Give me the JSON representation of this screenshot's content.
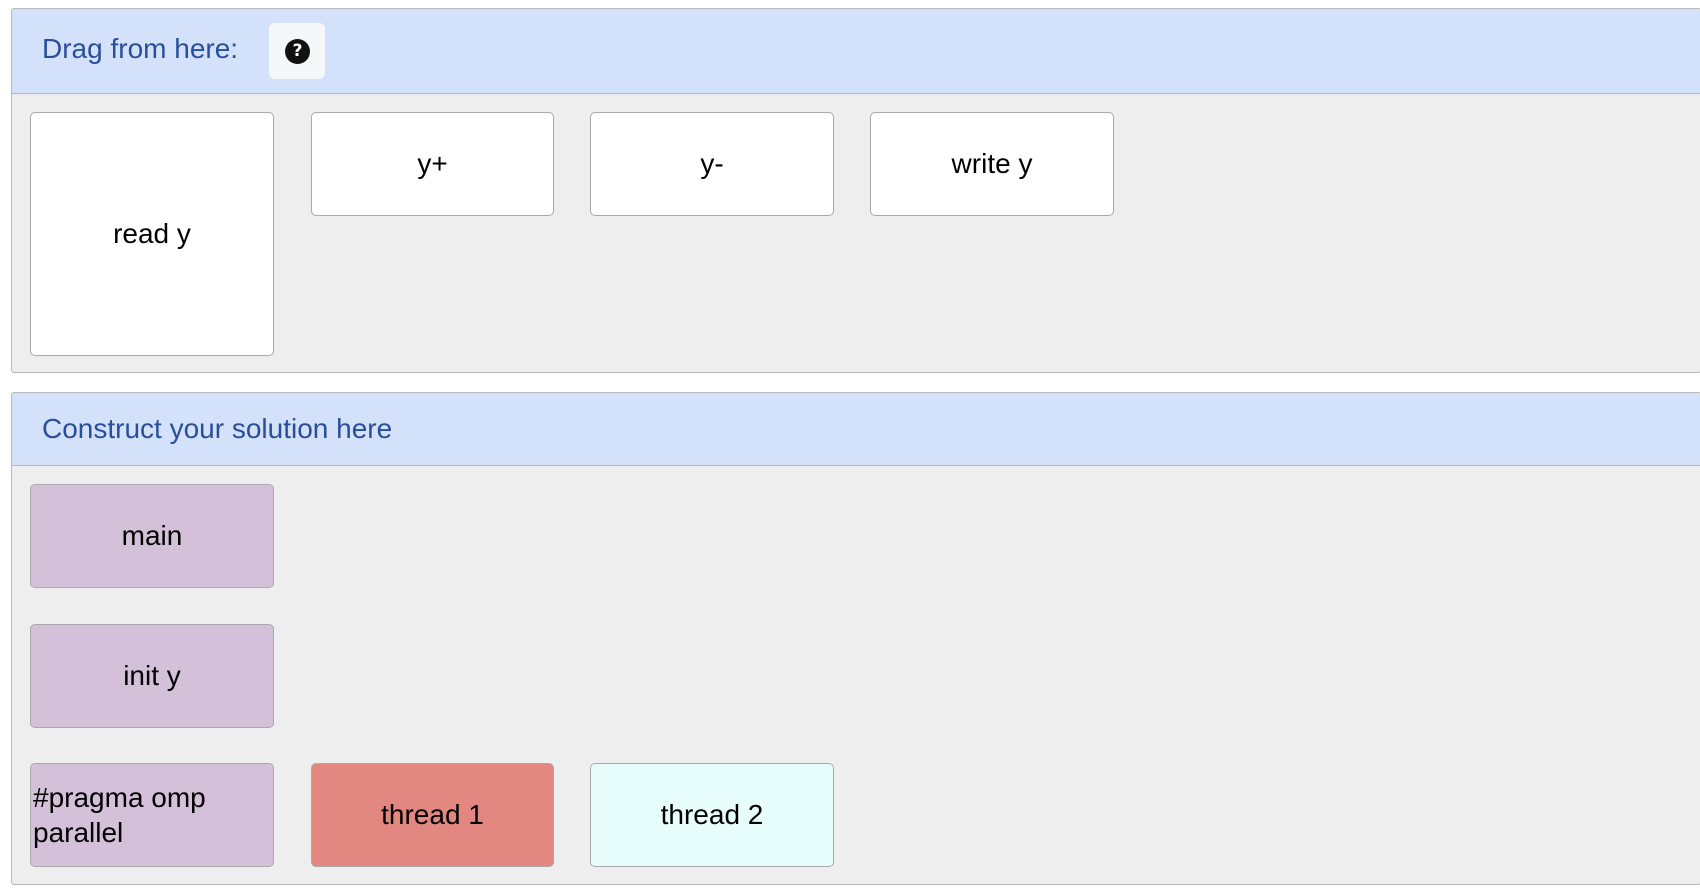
{
  "source": {
    "title": "Drag from here:",
    "help_icon": "question-circle-icon",
    "blocks": [
      {
        "label": "read y"
      },
      {
        "label": "y+"
      },
      {
        "label": "y-"
      },
      {
        "label": "write y"
      }
    ]
  },
  "target": {
    "title": "Construct your solution here",
    "blocks": [
      {
        "label": "main",
        "color": "#d4c0d8"
      },
      {
        "label": "init y",
        "color": "#d4c0d8"
      },
      {
        "label": "#pragma omp parallel",
        "color": "#d4c0d8"
      },
      {
        "label": "thread 1",
        "color": "#e38781"
      },
      {
        "label": "thread 2",
        "color": "#e6fdfc"
      }
    ]
  },
  "colors": {
    "header_bg": "#d3e1fa",
    "header_text": "#2a4f9a",
    "panel_bg": "#eeeeee"
  }
}
